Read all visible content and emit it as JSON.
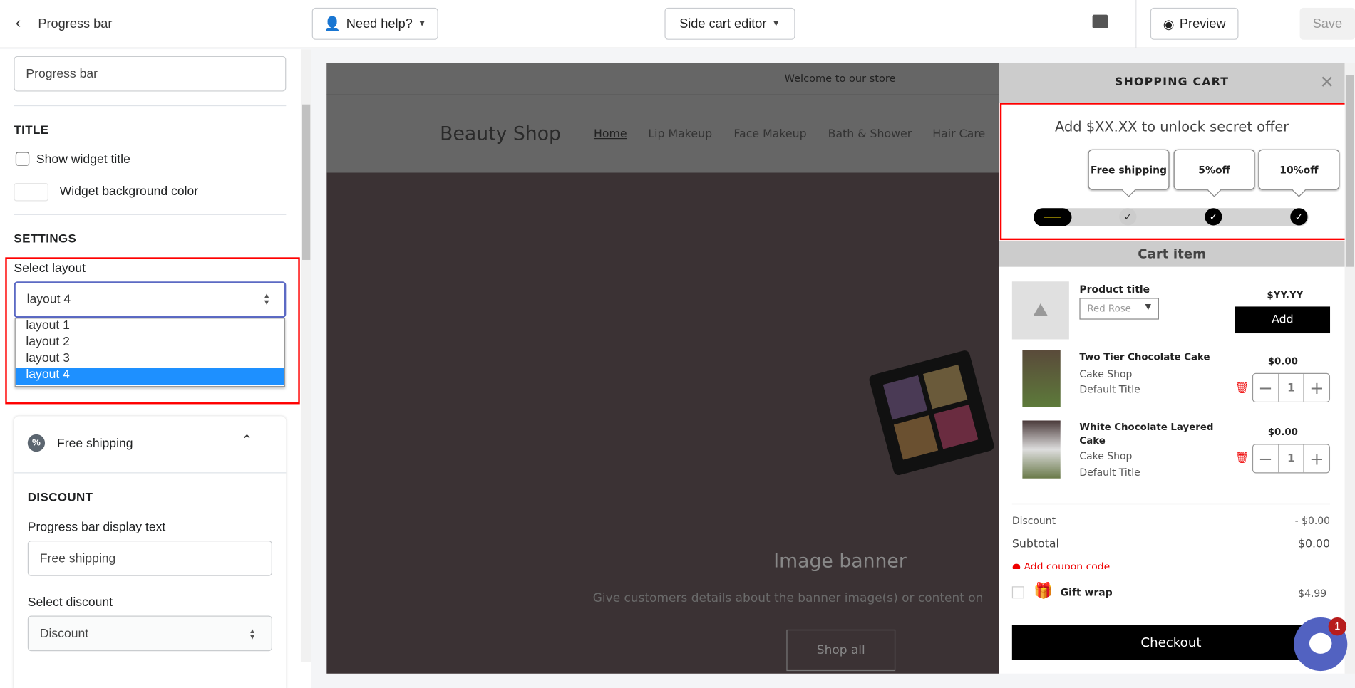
{
  "topbar": {
    "back_label": "Progress bar",
    "help_label": "Need help?",
    "editor_label": "Side cart editor",
    "preview_label": "Preview",
    "save_label": "Save"
  },
  "sidebar": {
    "name_value": "Progress bar",
    "title_heading": "TITLE",
    "show_title_label": "Show widget title",
    "show_title_checked": false,
    "bg_color_label": "Widget background color",
    "settings_heading": "SETTINGS",
    "layout_label": "Select layout",
    "layout_value": "layout 4",
    "layout_options": [
      "layout 1",
      "layout 2",
      "layout 3",
      "layout 4"
    ],
    "section_title": "Free shipping",
    "discount_heading": "DISCOUNT",
    "display_text_label": "Progress bar display text",
    "display_text_value": "Free shipping",
    "select_discount_label": "Select discount",
    "select_discount_value": "Discount"
  },
  "store": {
    "announcement": "Welcome to our store",
    "logo": "Beauty Shop",
    "nav": [
      "Home",
      "Lip Makeup",
      "Face Makeup",
      "Bath & Shower",
      "Hair Care"
    ],
    "banner_title": "Image banner",
    "banner_text": "Give customers details about the banner image(s) or content on",
    "banner_button": "Shop all"
  },
  "cart": {
    "title": "SHOPPING CART",
    "progress_text": "Add $XX.XX to unlock secret offer",
    "milestones": [
      "Free shipping",
      "5%off",
      "10%off"
    ],
    "progress_percent": 33,
    "cart_item_heading": "Cart item",
    "upsell": {
      "title": "Product title",
      "variant": "Red Rose",
      "price": "$YY.YY",
      "add_label": "Add"
    },
    "items": [
      {
        "title": "Two Tier Chocolate Cake",
        "vendor": "Cake Shop",
        "variant": "Default Title",
        "price": "$0.00",
        "qty": "1"
      },
      {
        "title": "White Chocolate Layered Cake",
        "vendor": "Cake Shop",
        "variant": "Default Title",
        "price": "$0.00",
        "qty": "1"
      }
    ],
    "discount_label": "Discount",
    "discount_value": "- $0.00",
    "subtotal_label": "Subtotal",
    "subtotal_value": "$0.00",
    "coupon_label": "Add coupon code",
    "gift_label": "Gift wrap",
    "gift_price": "$4.99",
    "checkout_label": "Checkout"
  },
  "chat": {
    "badge": "1"
  },
  "colors": {
    "accent": "#1e90ff",
    "highlight": "#ff0000",
    "chat": "#5262c1"
  }
}
